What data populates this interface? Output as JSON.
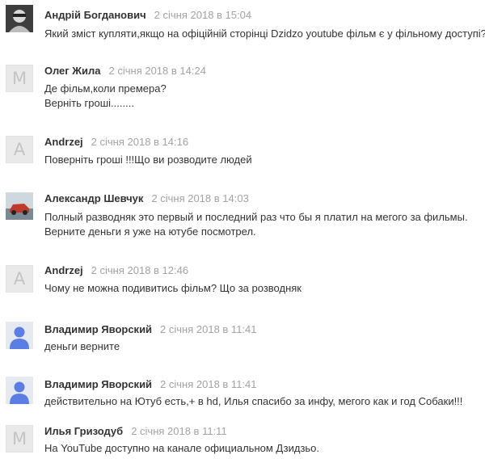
{
  "comments": [
    {
      "author": "Андрій Богданович",
      "date": "2 січня 2018 в 15:04",
      "lines": [
        "Який зміст купляти,якщо на офіційній сторінці Dzidzo youtube фільм є у фільному доступі?!"
      ],
      "avatar": {
        "type": "photo",
        "icon": "user-photo-icon"
      }
    },
    {
      "author": "Олег Жила",
      "date": "2 січня 2018 в 14:24",
      "lines": [
        "Де фільм,коли премера?",
        "Верніть гроші........"
      ],
      "avatar": {
        "type": "letter",
        "letter": "M"
      }
    },
    {
      "author": "Andrzej",
      "date": "2 січня 2018 в 14:16",
      "lines": [
        "Поверніть гроші !!!Що ви розводите людей"
      ],
      "avatar": {
        "type": "letter",
        "letter": "A"
      }
    },
    {
      "author": "Александр Шевчук",
      "date": "2 січня 2018 в 14:03",
      "lines": [
        "Полный разводняк это первый и последний раз что бы я платил на мегого за фильмы.",
        "Верните деньги я уже на ютубе посмотрел."
      ],
      "avatar": {
        "type": "photo",
        "icon": "car-photo-icon"
      }
    },
    {
      "author": "Andrzej",
      "date": "2 січня 2018 в 12:46",
      "lines": [
        "Чому не можна подивитись фільм? Що за розводняк"
      ],
      "avatar": {
        "type": "letter",
        "letter": "A"
      }
    },
    {
      "author": "Владимир Яворский",
      "date": "2 січня 2018 в 11:41",
      "lines": [
        "деньги верните"
      ],
      "avatar": {
        "type": "user",
        "icon": "default-user-icon"
      }
    },
    {
      "author": "Владимир Яворский",
      "date": "2 січня 2018 в 11:41",
      "lines": [
        "действительно на Ютуб есть,+ в hd, Илья спасибо за инфу, мегого как и год Собаки!!!"
      ],
      "avatar": {
        "type": "user",
        "icon": "default-user-icon"
      }
    },
    {
      "author": "Илья Гризодуб",
      "date": "2 січня 2018 в 11:11",
      "lines": [
        "На YouTube доступно на канале официальном Дзидзьо."
      ],
      "avatar": {
        "type": "letter",
        "letter": "M"
      }
    }
  ],
  "colors": {
    "author": "#333333",
    "date": "#a2a2a2",
    "text": "#333333",
    "letter_avatar_bg": "#e9e9e9",
    "letter_avatar_fg": "#c4c4c4",
    "user_avatar_fg": "#5b7ee5"
  }
}
